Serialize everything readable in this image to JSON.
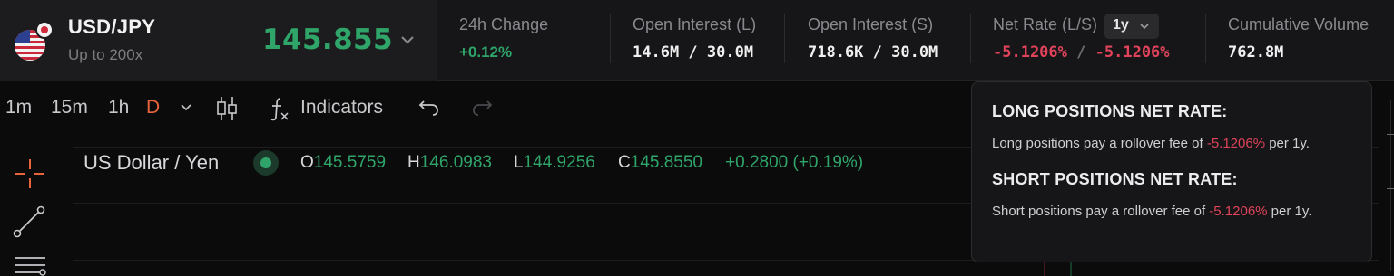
{
  "pair": {
    "symbol": "USD/JPY",
    "leverage": "Up to 200x",
    "price": "145.855"
  },
  "stats": {
    "change_label": "24h Change",
    "change_value": "+0.12%",
    "oi_long_label": "Open Interest (L)",
    "oi_long_value": "14.6M / 30.0M",
    "oi_short_label": "Open Interest (S)",
    "oi_short_value": "718.6K / 30.0M",
    "net_rate_label": "Net Rate (L/S)",
    "net_rate_period": "1y",
    "net_rate_long": "-5.1206%",
    "net_rate_sep": "/",
    "net_rate_short": "-5.1206%",
    "volume_label": "Cumulative Volume",
    "volume_value": "762.8M"
  },
  "toolbar": {
    "timeframes": [
      "1m",
      "15m",
      "1h",
      "D"
    ],
    "active_timeframe": "D",
    "indicators_label": "Indicators"
  },
  "chart": {
    "symbol_title": "US Dollar / Yen",
    "ohlc": {
      "o_label": "O",
      "o_value": "145.5759",
      "h_label": "H",
      "h_value": "146.0983",
      "l_label": "L",
      "l_value": "144.9256",
      "c_label": "C",
      "c_value": "145.8550",
      "change": "+0.2800 (+0.19%)"
    }
  },
  "tooltip": {
    "long_heading": "LONG POSITIONS NET RATE:",
    "long_text_before": "Long positions pay a rollover fee of ",
    "long_rate": "-5.1206%",
    "long_text_after": " per 1y.",
    "short_heading": "SHORT POSITIONS NET RATE:",
    "short_text_before": "Short positions pay a rollover fee of ",
    "short_rate": "-5.1206%",
    "short_text_after": " per 1y."
  },
  "colors": {
    "positive": "#2fa56a",
    "negative": "#e0435a",
    "active_timeframe": "#e8643a"
  },
  "icons": [
    "us-flag-icon",
    "japan-flag-icon",
    "chevron-down-icon",
    "candlestick-icon",
    "function-icon",
    "undo-icon",
    "redo-icon",
    "crosshair-icon",
    "trend-line-icon",
    "horizontal-lines-icon"
  ]
}
